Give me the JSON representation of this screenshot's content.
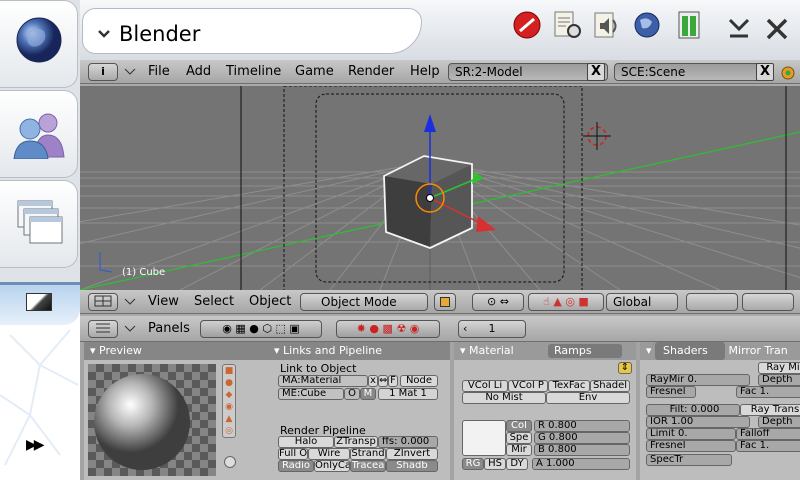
{
  "app": {
    "title": "Blender"
  },
  "main_header": {
    "menus": [
      "File",
      "Add",
      "Timeline",
      "Game",
      "Render",
      "Help"
    ],
    "screen": "SR:2-Model",
    "scene": "SCE:Scene",
    "x": "X"
  },
  "viewport": {
    "object_label": "(1) Cube",
    "menus": [
      "View",
      "Select",
      "Object"
    ],
    "mode": "Object Mode",
    "orientation": "Global"
  },
  "buttons_header": {
    "label": "Panels",
    "frame": "1"
  },
  "preview": {
    "title": "Preview"
  },
  "links": {
    "title": "Links and Pipeline",
    "link_to_object": "Link to Object",
    "material": "MA:Material",
    "x": "x",
    "f": "F",
    "node": "Node",
    "mesh": "ME:Cube",
    "o": "O",
    "m": "M",
    "mat_count": "1 Mat 1",
    "render_pipeline": "Render Pipeline",
    "halo": "Halo",
    "ztransp": "ZTransp",
    "zoffs": "ffs: 0.000",
    "full_osa": "Full Os",
    "wire": "Wire",
    "strands": "Strand",
    "zinvert": "ZInvert",
    "radio": "Radio",
    "only_cast": "OnlyCa",
    "traceable": "Tracea",
    "shadbuf": "Shadb"
  },
  "material": {
    "tab_material": "Material",
    "tab_ramps": "Ramps",
    "vcol_light": "VCol Li",
    "vcol_paint": "VCol P",
    "texface": "TexFac",
    "shadeless": "Shadel",
    "no_mist": "No Mist",
    "env": "Env",
    "col": "Col",
    "spe": "Spe",
    "mir": "Mir",
    "r": "R 0.800",
    "g": "G 0.800",
    "b": "B 0.800",
    "a": "A 1.000",
    "rgb": "RG",
    "hsv": "HS",
    "dyn": "DY"
  },
  "shaders": {
    "tab_shaders": "Shaders",
    "tab_mirror": "Mirror Tran",
    "raymir": "RayMir 0.",
    "ray_mirror": "Ray Mi",
    "fresnel": "Fresnel",
    "depth": "Depth",
    "fac": "Fac 1.",
    "filt": "Filt: 0.000",
    "ray_transp": "Ray Trans",
    "ior": "IOR 1.00",
    "depth2": "Depth",
    "limit": "Limit 0.",
    "falloff": "Falloff",
    "fresnel2": "Fresnel",
    "fac2": "Fac 1.",
    "spectr": "SpecTr"
  },
  "colors": {
    "viewport_bg": "#747474",
    "x_axis": "#d83030",
    "y_axis": "#30c030",
    "z_axis": "#1a2ee0"
  }
}
